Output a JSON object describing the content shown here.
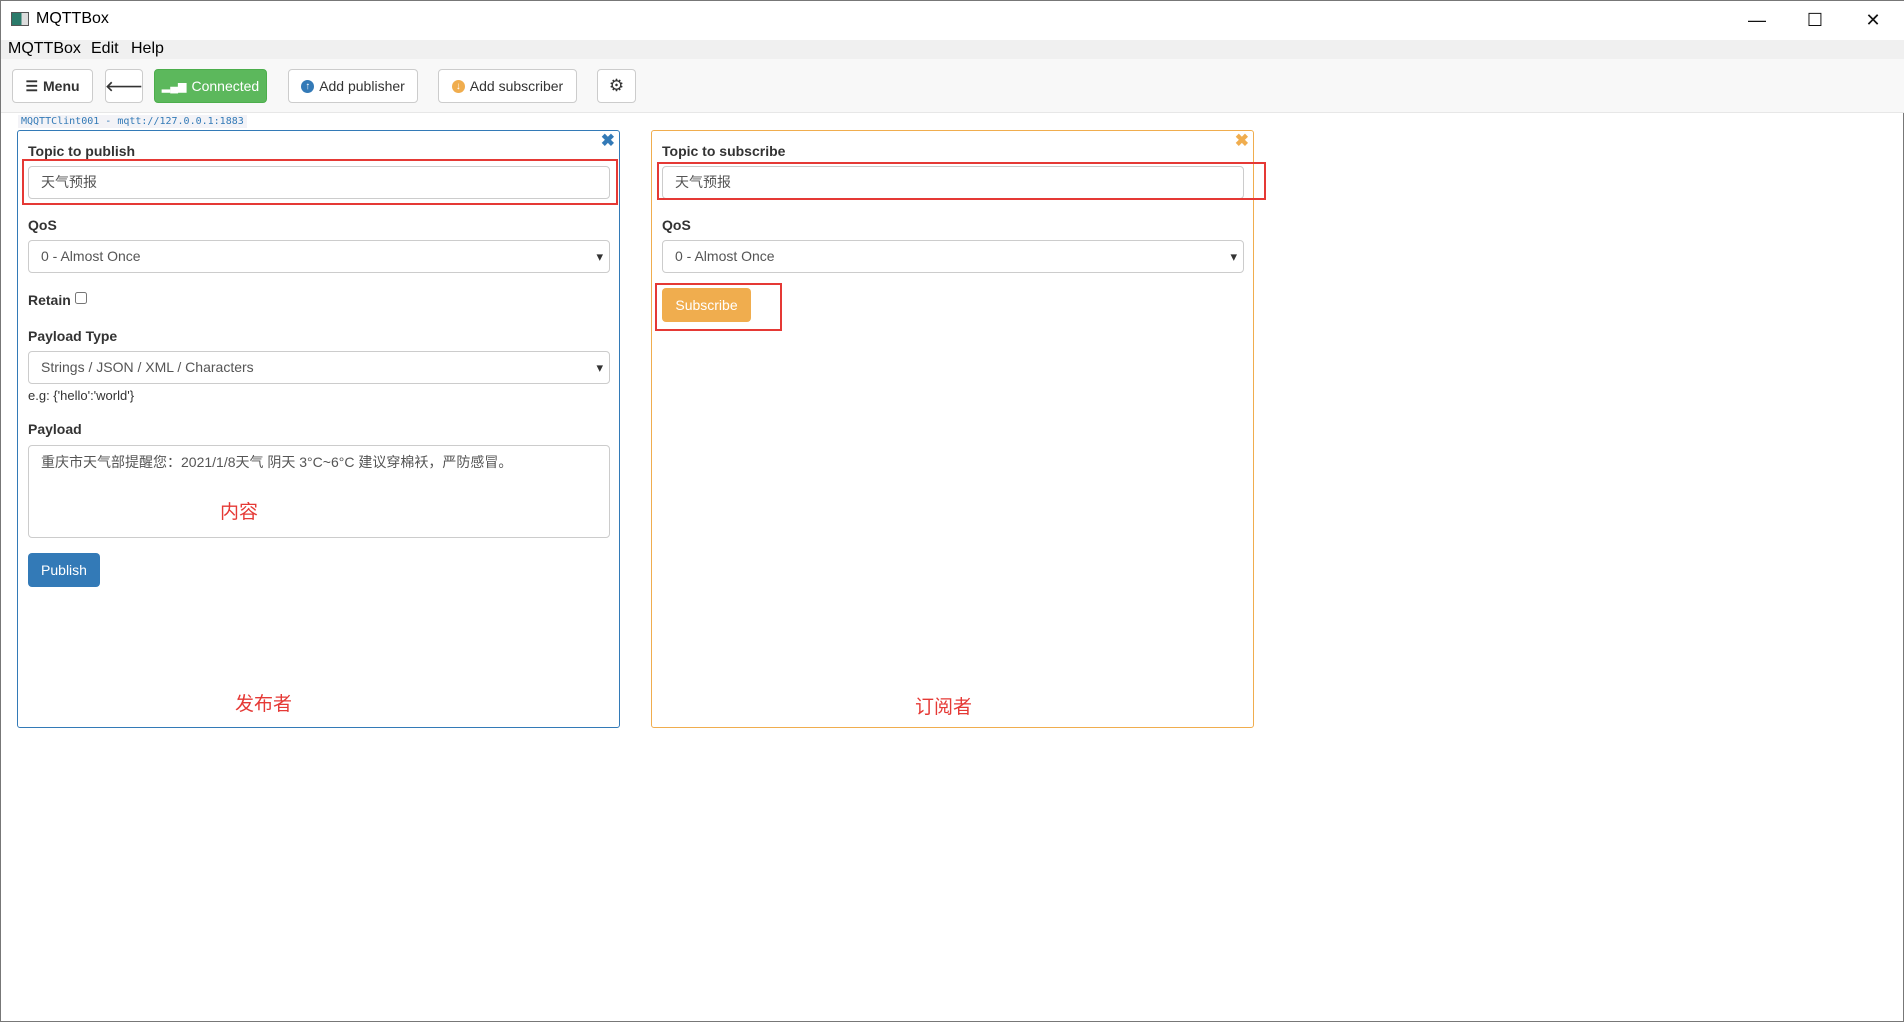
{
  "window": {
    "title": "MQTTBox",
    "minimize": "—",
    "maximize": "☐",
    "close": "✕"
  },
  "menubar": [
    "MQTTBox",
    "Edit",
    "Help"
  ],
  "toolbar": {
    "menu": "Menu",
    "back": "🡐",
    "connected": "Connected",
    "add_publisher": "Add publisher",
    "add_subscriber": "Add subscriber",
    "settings": "⚙"
  },
  "client_label": "MQQTTClint001 - mqtt://127.0.0.1:1883",
  "colors": {
    "publisher": "#337ab7",
    "subscriber": "#f0ad4e",
    "connected": "#5cb85c",
    "annotation": "#e53935"
  },
  "publisher": {
    "topic_label": "Topic to publish",
    "topic_value": "天气预报",
    "qos_label": "QoS",
    "qos_value": "0 - Almost Once",
    "retain_label": "Retain",
    "retain_checked": false,
    "payload_type_label": "Payload Type",
    "payload_type_value": "Strings / JSON / XML / Characters",
    "payload_hint": "e.g: {'hello':'world'}",
    "payload_label": "Payload",
    "payload_value": "重庆市天气部提醒您：2021/1/8天气  阴天  3°C~6°C  建议穿棉袄，严防感冒。",
    "publish_button": "Publish",
    "close": "✖"
  },
  "subscriber": {
    "topic_label": "Topic to subscribe",
    "topic_value": "天气预报",
    "qos_label": "QoS",
    "qos_value": "0 - Almost Once",
    "subscribe_button": "Subscribe",
    "close": "✖"
  },
  "annotations": {
    "content": "内容",
    "publisher": "发布者",
    "subscriber": "订阅者"
  }
}
